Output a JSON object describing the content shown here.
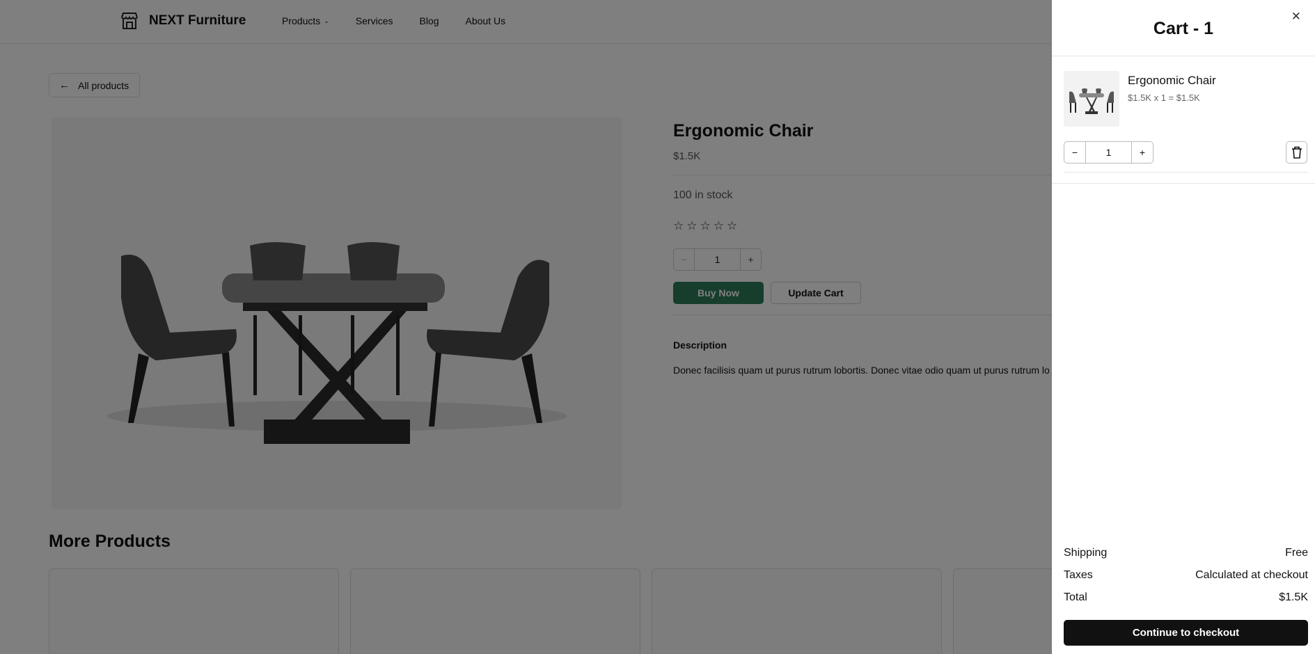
{
  "header": {
    "brand": "NEXT Furniture",
    "nav": [
      {
        "label": "Products",
        "has_dropdown": true
      },
      {
        "label": "Services"
      },
      {
        "label": "Blog"
      },
      {
        "label": "About Us"
      }
    ]
  },
  "back_link": {
    "label": "All products"
  },
  "product": {
    "title": "Ergonomic Chair",
    "price": "$1.5K",
    "stock": "100 in stock",
    "rating": 0,
    "rating_max": 5,
    "quantity": "1",
    "buy_label": "Buy Now",
    "update_label": "Update Cart",
    "description_heading": "Description",
    "description": "Donec facilisis quam ut purus rutrum lobortis. Donec vitae odio quam ut purus rutrum lo"
  },
  "more_products": {
    "title": "More Products"
  },
  "cart": {
    "title": "Cart - 1",
    "items": [
      {
        "name": "Ergonomic Chair",
        "subtotal": "$1.5K x 1 = $1.5K",
        "quantity": "1"
      }
    ],
    "summary": {
      "shipping_label": "Shipping",
      "shipping_value": "Free",
      "taxes_label": "Taxes",
      "taxes_value": "Calculated at checkout",
      "total_label": "Total",
      "total_value": "$1.5K"
    },
    "checkout_label": "Continue to checkout"
  },
  "colors": {
    "buy_button": "#2e7d5b",
    "checkout_button": "#111111",
    "overlay": "rgba(0,0,0,0.5)"
  }
}
